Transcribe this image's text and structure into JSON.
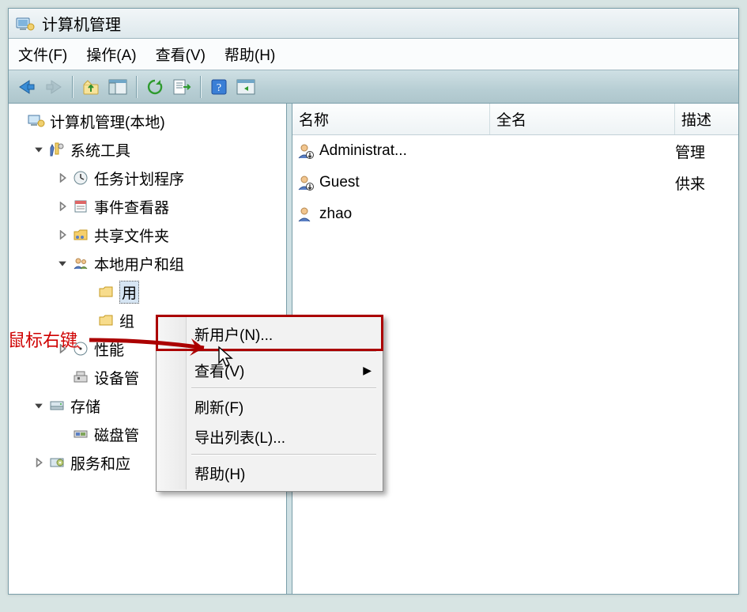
{
  "window": {
    "title": "计算机管理"
  },
  "menubar": {
    "file": "文件(F)",
    "action": "操作(A)",
    "view": "查看(V)",
    "help": "帮助(H)"
  },
  "tree": {
    "root": "计算机管理(本地)",
    "system_tools": "系统工具",
    "task_scheduler": "任务计划程序",
    "event_viewer": "事件查看器",
    "shared_folders": "共享文件夹",
    "local_users_groups": "本地用户和组",
    "users": "用户",
    "users_truncated": "用",
    "groups": "组",
    "performance": "性能",
    "device_manager_trunc": "设备管",
    "storage": "存储",
    "disk_mgmt_trunc": "磁盘管",
    "services_trunc": "服务和应"
  },
  "list": {
    "columns": {
      "name": "名称",
      "fullname": "全名",
      "desc": "描述"
    },
    "rows": [
      {
        "name": "Administrat...",
        "fullname": "",
        "desc": "管理"
      },
      {
        "name": "Guest",
        "fullname": "",
        "desc": "供来"
      },
      {
        "name": "zhao",
        "fullname": "",
        "desc": ""
      }
    ]
  },
  "context_menu": {
    "new_user": "新用户(N)...",
    "view": "查看(V)",
    "refresh": "刷新(F)",
    "export_list": "导出列表(L)...",
    "help": "帮助(H)"
  },
  "annotation": {
    "label": "鼠标右键"
  }
}
